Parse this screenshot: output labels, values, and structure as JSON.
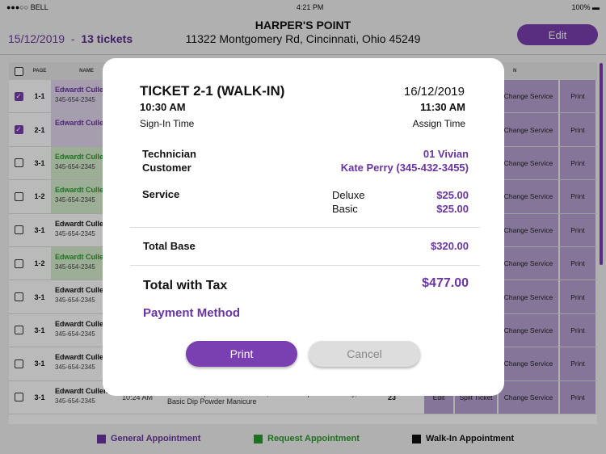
{
  "status": {
    "carrier": "BELL",
    "time": "4:21 PM",
    "battery": "100%"
  },
  "header": {
    "store": "HARPER'S POINT",
    "address": "11322 Montgomery Rd, Cincinnati, Ohio 45249",
    "date": "15/12/2019",
    "separator": "-",
    "tickets": "13 tickets",
    "edit": "Edit"
  },
  "table": {
    "headers": {
      "page": "PAGE",
      "name": "NAME",
      "action": "N"
    },
    "rows": [
      {
        "page": "1-1",
        "name": "Edwardt Culle",
        "phone": "345-654-2345",
        "color": "#6a35a0",
        "checked": true,
        "hl": "#e4d8f0"
      },
      {
        "page": "2-1",
        "name": "Edwardt Culle",
        "phone": "",
        "color": "#6a35a0",
        "checked": true,
        "hl": "#e4d8f0"
      },
      {
        "page": "3-1",
        "name": "Edwardt Culle",
        "phone": "345-654-2345",
        "color": "#2a9a2a",
        "checked": false,
        "hl": "#d8efd0"
      },
      {
        "page": "1-2",
        "name": "Edwardt Culle",
        "phone": "345-654-2345",
        "color": "#2a9a2a",
        "checked": false,
        "hl": "#d8efd0"
      },
      {
        "page": "3-1",
        "name": "Edwardt Culle",
        "phone": "345-654-2345",
        "color": "#111111",
        "checked": false,
        "hl": ""
      },
      {
        "page": "1-2",
        "name": "Edwardt Culle",
        "phone": "345-654-2345",
        "color": "#2a9a2a",
        "checked": false,
        "hl": "#d8efd0"
      },
      {
        "page": "3-1",
        "name": "Edwardt Culle",
        "phone": "345-654-2345",
        "color": "#111111",
        "checked": false,
        "hl": ""
      },
      {
        "page": "3-1",
        "name": "Edwardt Culle",
        "phone": "345-654-2345",
        "color": "#111111",
        "checked": false,
        "hl": ""
      },
      {
        "page": "3-1",
        "name": "Edwardt Culle",
        "phone": "345-654-2345",
        "color": "#111111",
        "checked": false,
        "hl": ""
      },
      {
        "page": "3-1",
        "name": "Edwardt Cullen",
        "phone": "345-654-2345",
        "color": "#111111",
        "checked": false,
        "hl": "",
        "time": "10:24 AM",
        "service": "Princess Dip Powder Manicure, Princess Dip Powder Only, Basic Dip Powder Manicure",
        "num": "23"
      }
    ],
    "actions": {
      "edit": "Edit",
      "split": "Split Ticket",
      "change": "Change Service",
      "print": "Print"
    }
  },
  "legend": {
    "general": "General Appointment",
    "request": "Request Appointment",
    "walkin": "Walk-In Appointment"
  },
  "modal": {
    "title": "TICKET 2-1 (WALK-IN)",
    "date": "16/12/2019",
    "signin_time": "10:30 AM",
    "signin_label": "Sign-In Time",
    "assign_time": "11:30 AM",
    "assign_label": "Assign Time",
    "technician_label": "Technician",
    "technician": "01 Vivian",
    "customer_label": "Customer",
    "customer": "Kate Perry (345-432-3455)",
    "service_label": "Service",
    "services": [
      {
        "name": "Deluxe",
        "price": "$25.00"
      },
      {
        "name": "Basic",
        "price": "$25.00"
      }
    ],
    "total_base_label": "Total Base",
    "total_base": "$320.00",
    "total_tax_label": "Total with Tax",
    "total_tax": "$477.00",
    "payment_label": "Payment Method",
    "print": "Print",
    "cancel": "Cancel"
  },
  "colors": {
    "accent": "#7a3fb0",
    "request": "#2a9a2a",
    "walkin": "#111111"
  }
}
